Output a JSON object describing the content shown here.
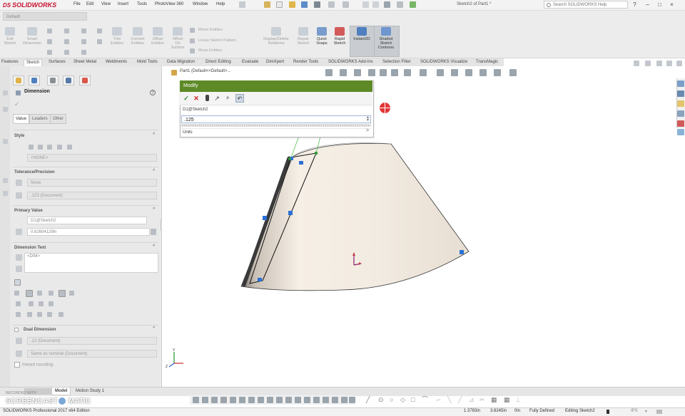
{
  "app": {
    "logo_ds": "DS",
    "logo_name": "SOLIDWORKS",
    "document_title": "Sketch2 of Part1 *",
    "search_placeholder": "Search SOLIDWORKS Help",
    "help_label": "?",
    "config_name": "Default"
  },
  "menus": [
    "File",
    "Edit",
    "View",
    "Insert",
    "Tools",
    "PhotoView 360",
    "Window",
    "Help"
  ],
  "commands": {
    "exit_sketch": [
      "Exit",
      "Sketch"
    ],
    "smart_dimension": [
      "Smart",
      "Dimension"
    ],
    "trim_entities": [
      "Trim",
      "Entities"
    ],
    "convert_entities": [
      "Convert",
      "Entities"
    ],
    "offset_entities": [
      "Offset",
      "Entities"
    ],
    "offset_on_surface": [
      "Offset",
      "On",
      "Surface"
    ],
    "mirror_entities": "Mirror Entities",
    "linear_sketch_pattern": "Linear Sketch Pattern",
    "move_entities": "Move Entities",
    "display_delete_relations": [
      "Display/Delete",
      "Relations"
    ],
    "repair_sketch": [
      "Repair",
      "Sketch"
    ],
    "quick_snaps": [
      "Quick",
      "Snaps"
    ],
    "rapid_sketch": [
      "Rapid",
      "Sketch"
    ],
    "instant2d": "Instant2D",
    "shaded_sketch_contours": [
      "Shaded",
      "Sketch",
      "Contours"
    ]
  },
  "tabs": [
    "Features",
    "Sketch",
    "Surfaces",
    "Sheet Metal",
    "Weldments",
    "Mold Tools",
    "Data Migration",
    "Direct Editing",
    "Evaluate",
    "DimXpert",
    "Render Tools",
    "SOLIDWORKS Add-Ins",
    "Selection Filter",
    "SOLIDWORKS Visualize",
    "TransMagic"
  ],
  "active_tab": "Sketch",
  "property_manager": {
    "title": "Dimension",
    "help": "?",
    "ok": "✓",
    "subtabs": [
      "Value",
      "Leaders",
      "Other"
    ],
    "style_title": "Style",
    "style_value": "<NONE>",
    "tolerance_title": "Tolerance/Precision",
    "tolerance_type": "None",
    "precision": ".123 (Document)",
    "primary_value_title": "Primary Value",
    "primary_name": "D1@Sketch2",
    "primary_value": "0.62604129in",
    "dimension_text_title": "Dimension Text",
    "dimension_text": "<DIM>",
    "dual_dimension_title": "Dual Dimension",
    "dual_precision": ".12 (Document)",
    "dual_tolerance": "Same as nominal (Document)",
    "inward_rounding": "Inward rounding"
  },
  "graphics": {
    "breadcrumb": "Part1  (Default<<Default>..."
  },
  "modify_dialog": {
    "title": "Modify",
    "dimension_name": "D1@Sketch2",
    "value": ".125",
    "units_label": "Units",
    "units_chevron": ">"
  },
  "bottom_tabs": [
    "Model",
    "Motion Study 1"
  ],
  "active_bottom_tab": "Model",
  "watermark": {
    "recorded_with": "RECORDED WITH",
    "brand": "SCREENCAST",
    "brand_suffix": "MATIC"
  },
  "status_bar": {
    "edition": "SOLIDWORKS Professional 2017 x64 Edition",
    "x": "1.3783in",
    "y": "3.8245in",
    "z": "0in",
    "state": "Fully Defined",
    "editing": "Editing Sketch2",
    "units": "IPS"
  },
  "colors": {
    "modify_header": "#5d8a26",
    "ok_green": "#2e8b2e",
    "cancel_red": "#cc2222",
    "crosshair_red": "#d4202a",
    "sketch_blue": "#2a6fd6",
    "model_face": "#f3ece2"
  }
}
